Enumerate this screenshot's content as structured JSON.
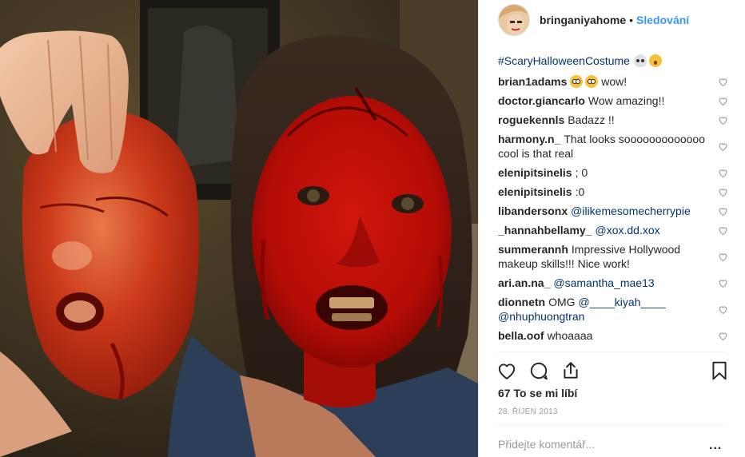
{
  "header": {
    "username": "bringaniyahome",
    "separator": "•",
    "follow_label": "Sledování"
  },
  "caption_tail": {
    "hashtag": "#ScaryHalloweenCostume",
    "emojis": [
      "skull-emoji",
      "scream-cat-emoji"
    ]
  },
  "comments": [
    {
      "user": "brian1adams",
      "text": "wow!",
      "emojis_before": [
        "flushed-emoji",
        "flushed-emoji"
      ]
    },
    {
      "user": "doctor.giancarlo",
      "text": "Wow amazing!!"
    },
    {
      "user": "roguekennls",
      "text": "Badazz !!"
    },
    {
      "user": "harmony.n_",
      "text": "That looks sooooooooooooo cool is that real"
    },
    {
      "user": "elenipitsinelis",
      "text": "; 0"
    },
    {
      "user": "elenipitsinelis",
      "text": ":0"
    },
    {
      "user": "libandersonx",
      "mention": "@ilikemesomecherrypie"
    },
    {
      "user": "_hannahbellamy_",
      "mention": "@xox.dd.xox"
    },
    {
      "user": "summerannh",
      "text": "Impressive Hollywood makeup skills!!! Nice work!"
    },
    {
      "user": "ari.an.na_",
      "mention": "@samantha_mae13"
    },
    {
      "user": "dionnetn",
      "text": "OMG",
      "mention": "@____kiyah____ @nhuphuongtran"
    },
    {
      "user": "bella.oof",
      "text": "whoaaaa"
    }
  ],
  "actions": {
    "like_icon": "heart-icon",
    "comment_icon": "comment-icon",
    "share_icon": "share-icon",
    "save_icon": "bookmark-icon"
  },
  "likes_label": "67 To se mi líbí",
  "date_label": "28. ŘÍJEN 2013",
  "add_comment_placeholder": "Přidejte komentář...",
  "more_label": "...",
  "colors": {
    "link": "#3897f0",
    "mention": "#003569",
    "muted": "#999999",
    "text": "#262626",
    "divider": "#efefef"
  }
}
